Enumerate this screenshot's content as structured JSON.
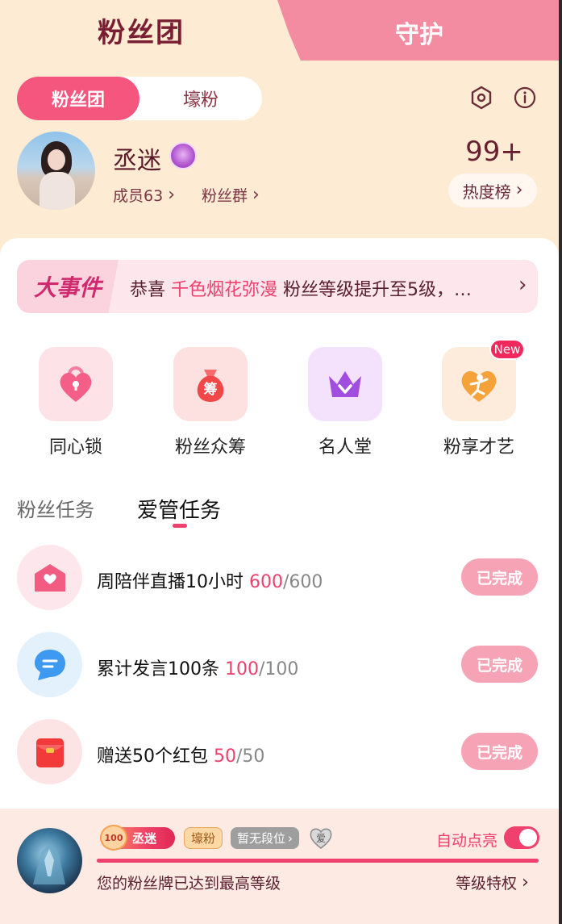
{
  "tabs": {
    "main": "粉丝团",
    "guard": "守护"
  },
  "toggle": {
    "on": "粉丝团",
    "off": "壕粉"
  },
  "icons": {
    "settings": "hexagon-settings-icon",
    "info": "info-icon"
  },
  "profile": {
    "name": "丞迷",
    "members": "成员63",
    "group": "粉丝群",
    "score": "99+",
    "rank_label": "热度榜"
  },
  "event": {
    "tag": "大事件",
    "prefix": "恭喜 ",
    "highlight": "千色烟花弥漫",
    "suffix": " 粉丝等级提升至5级，…"
  },
  "features": [
    {
      "label": "同心锁",
      "icon": "heart-lock-icon"
    },
    {
      "label": "粉丝众筹",
      "icon": "money-bag-icon",
      "glyph": "筹"
    },
    {
      "label": "名人堂",
      "icon": "crown-icon"
    },
    {
      "label": "粉享才艺",
      "icon": "dancer-heart-icon",
      "badge": "New"
    }
  ],
  "task_tabs": {
    "inactive": "粉丝任务",
    "active": "爱管任务"
  },
  "tasks": [
    {
      "title": "周陪伴直播10小时 ",
      "current": "600",
      "total": "/600",
      "status": "已完成",
      "icon": "mail-heart-icon"
    },
    {
      "title": "累计发言100条 ",
      "current": "100",
      "total": "/100",
      "status": "已完成",
      "icon": "chat-bubble-icon"
    },
    {
      "title": "赠送50个红包 ",
      "current": "50",
      "total": "/50",
      "status": "已完成",
      "icon": "red-envelope-icon"
    }
  ],
  "bottom": {
    "medal_level": "100",
    "medal_name": "丞迷",
    "fan_chip": "壕粉",
    "rank_chip": "暂无段位",
    "heart_glyph": "爱",
    "auto_label": "自动点亮",
    "auto_on": true,
    "progress": 1.0,
    "message": "您的粉丝牌已达到最高等级",
    "perk_link": "等级特权"
  },
  "colors": {
    "accent": "#f0406d",
    "panel_bg": "#fdebd3",
    "guard_tab": "#f38ca1",
    "done_btn": "#f6a3b5"
  }
}
